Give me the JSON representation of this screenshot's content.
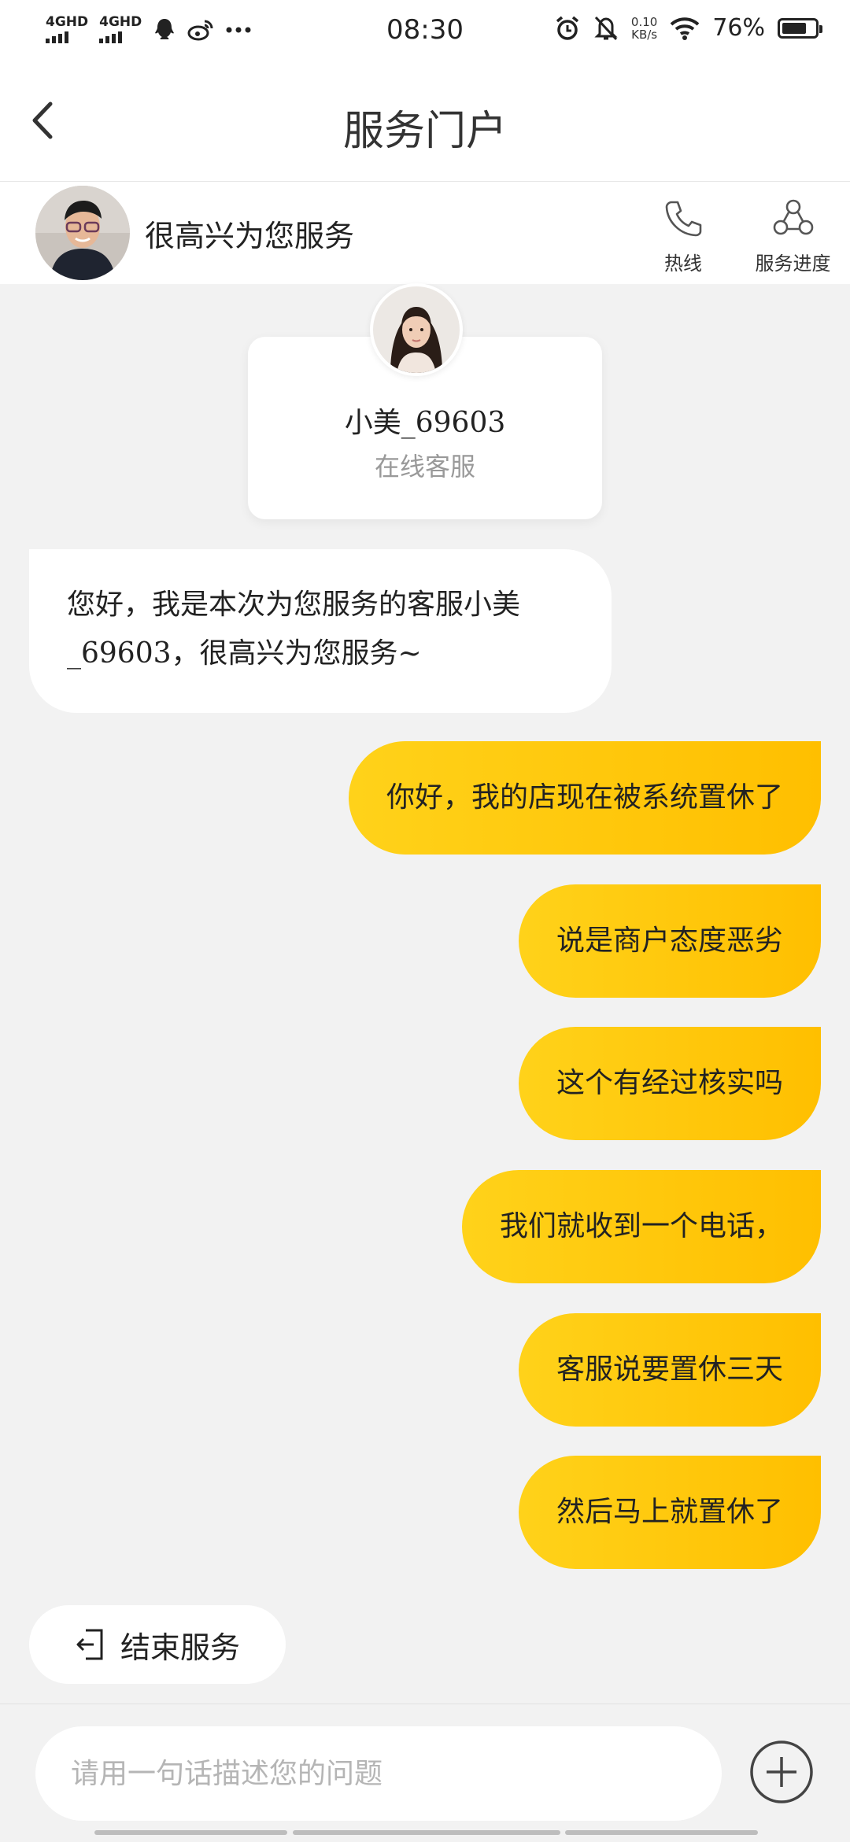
{
  "status_bar": {
    "signal1": "4GHD",
    "signal2": "4GHD",
    "time": "08:30",
    "speed_value": "0.10",
    "speed_unit": "KB/s",
    "battery": "76%",
    "battery_level": 0.76
  },
  "header": {
    "title": "服务门户"
  },
  "agent_bar": {
    "greeting": "很高兴为您服务",
    "hotline_label": "热线",
    "progress_label": "服务进度"
  },
  "agent_card": {
    "name": "小美_69603",
    "role": "在线客服"
  },
  "messages": {
    "incoming": "您好，我是本次为您服务的客服小美_69603，很高兴为您服务~",
    "outgoing": [
      "你好，我的店现在被系统置休了",
      "说是商户态度恶劣",
      "这个有经过核实吗",
      "我们就收到一个电话，",
      "客服说要置休三天",
      "然后马上就置休了"
    ]
  },
  "end_service_label": "结束服务",
  "input": {
    "placeholder": "请用一句话描述您的问题"
  },
  "colors": {
    "accent_start": "#ffd21a",
    "accent_end": "#ffbf00",
    "background": "#f2f2f2"
  }
}
